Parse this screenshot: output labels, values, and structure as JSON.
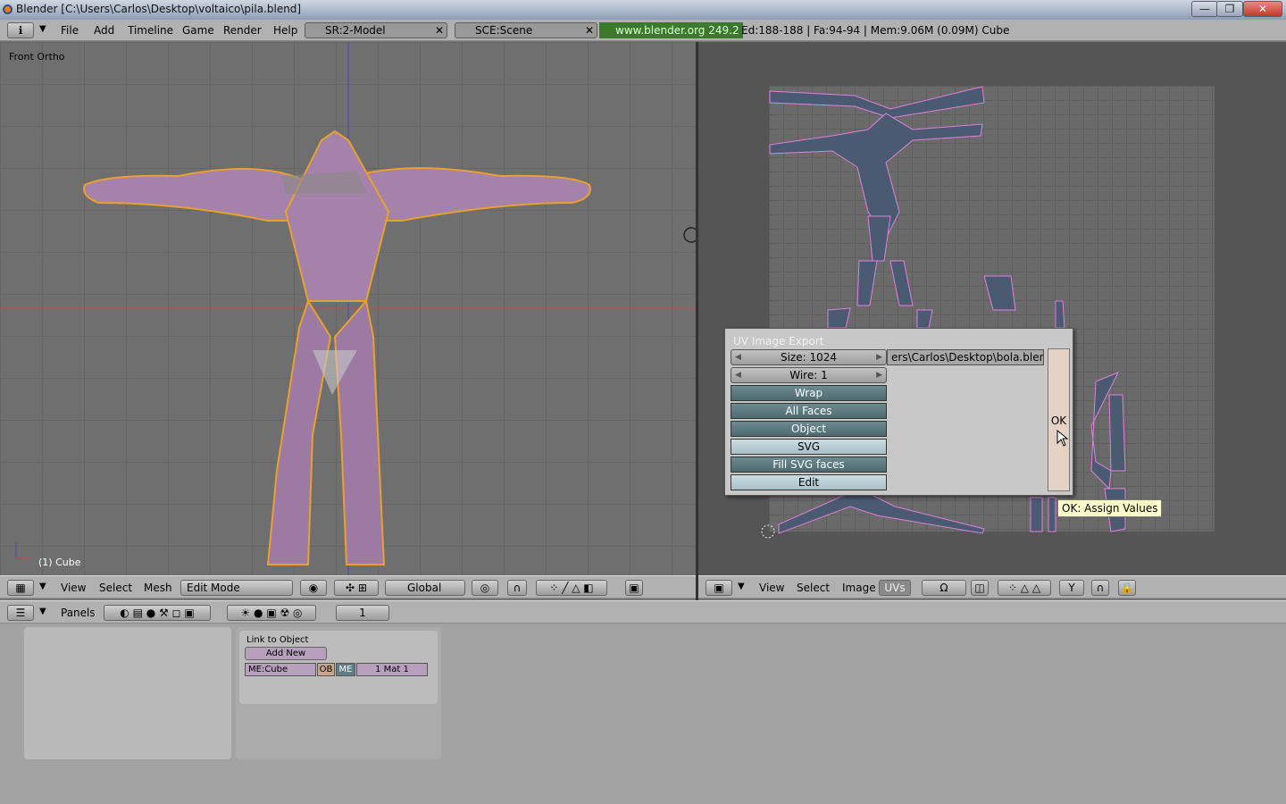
{
  "window": {
    "title": "Blender [C:\\Users\\Carlos\\Desktop\\voltaico\\pila.blend]",
    "min": "—",
    "max": "❐",
    "close": "✕"
  },
  "topbar": {
    "menus": [
      "File",
      "Add",
      "Timeline",
      "Game",
      "Render",
      "Help"
    ],
    "screen": "SR:2-Model",
    "scene": "SCE:Scene",
    "url": "www.blender.org 249.2",
    "stats": "Ed:188-188 | Fa:94-94 | Mem:9.06M (0.09M) Cube"
  },
  "viewport": {
    "view_label": "Front Ortho",
    "object_label": "(1) Cube"
  },
  "view3d_header": {
    "menus": [
      "View",
      "Select",
      "Mesh"
    ],
    "mode": "Edit Mode",
    "orientation": "Global"
  },
  "uv_header": {
    "menus": [
      "View",
      "Select",
      "Image"
    ],
    "uvs": "UVs"
  },
  "buttons_header": {
    "panels": "Panels",
    "frame": "1"
  },
  "link_panel": {
    "title": "Link to Object",
    "add_new": "Add New",
    "mesh": "ME:Cube",
    "ob": "OB",
    "me": "ME",
    "mat": "1 Mat 1"
  },
  "dialog": {
    "title": "UV Image Export",
    "size": "Size: 1024",
    "wire": "Wire: 1",
    "buttons": [
      "Wrap",
      "All Faces",
      "Object",
      "SVG",
      "Fill SVG faces",
      "Edit"
    ],
    "file": "ers\\Carlos\\Desktop\\bola.blend",
    "ok": "OK"
  },
  "tooltip": "OK: Assign Values",
  "colors": {
    "mesh": "#a080a8",
    "wire": "#e8a030",
    "uv_face": "#4a5a70",
    "uv_edge": "#e080e0"
  }
}
